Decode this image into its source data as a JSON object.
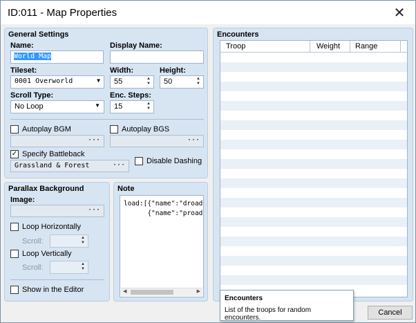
{
  "window": {
    "title": "ID:011 - Map Properties"
  },
  "general": {
    "heading": "General Settings",
    "name_label": "Name:",
    "name_value": "World Map",
    "display_name_label": "Display Name:",
    "display_name_value": "",
    "tileset_label": "Tileset:",
    "tileset_value": "0001 Overworld",
    "width_label": "Width:",
    "width_value": "55",
    "height_label": "Height:",
    "height_value": "50",
    "scroll_type_label": "Scroll Type:",
    "scroll_type_value": "No Loop",
    "enc_steps_label": "Enc. Steps:",
    "enc_steps_value": "15",
    "autoplay_bgm_label": "Autoplay BGM",
    "autoplay_bgm_checked": false,
    "autoplay_bgs_label": "Autoplay BGS",
    "autoplay_bgs_checked": false,
    "specify_battleback_label": "Specify Battleback",
    "specify_battleback_checked": true,
    "battleback_value": "Grassland & Forest",
    "disable_dashing_label": "Disable Dashing",
    "disable_dashing_checked": false,
    "browse": "···"
  },
  "parallax": {
    "heading": "Parallax Background",
    "image_label": "Image:",
    "image_value": "",
    "loop_h_label": "Loop Horizontally",
    "loop_v_label": "Loop Vertically",
    "scroll_label": "Scroll:",
    "show_editor_label": "Show in the Editor"
  },
  "note": {
    "heading": "Note",
    "text": "load:[{\"name\":\"droad\",\"\n      {\"name\":\"proad\",\""
  },
  "encounters": {
    "heading": "Encounters",
    "columns": [
      "Troop",
      "Weight",
      "Range"
    ]
  },
  "tooltip": {
    "title": "Encounters",
    "text": "List of the troops for random encounters."
  },
  "buttons": {
    "cancel": "Cancel"
  }
}
